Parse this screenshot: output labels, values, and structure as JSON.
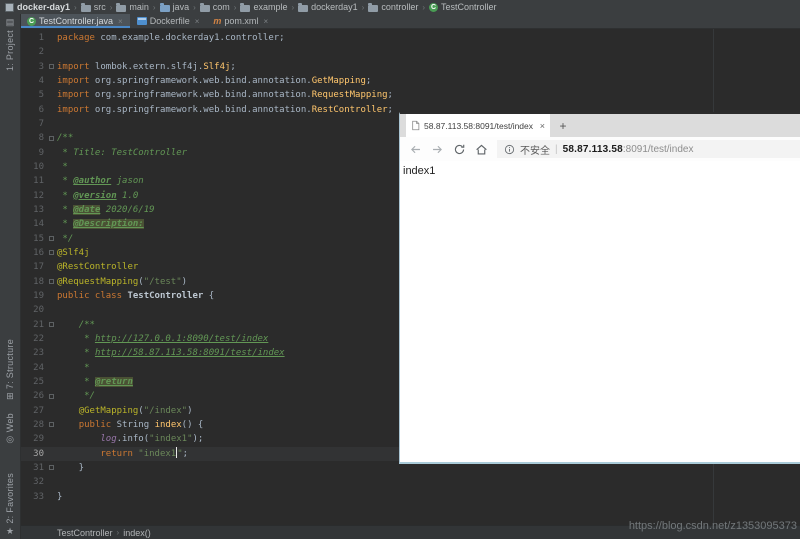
{
  "ide": {
    "breadcrumb": {
      "items": [
        {
          "label": "docker-day1",
          "icon": "project"
        },
        {
          "label": "src",
          "icon": "folder"
        },
        {
          "label": "main",
          "icon": "folder"
        },
        {
          "label": "java",
          "icon": "java-folder"
        },
        {
          "label": "com",
          "icon": "folder"
        },
        {
          "label": "example",
          "icon": "folder"
        },
        {
          "label": "dockerday1",
          "icon": "folder"
        },
        {
          "label": "controller",
          "icon": "folder"
        },
        {
          "label": "TestController",
          "icon": "class"
        }
      ]
    },
    "tabs": [
      {
        "label": "TestController.java",
        "icon": "class",
        "close": "×",
        "active": true
      },
      {
        "label": "Dockerfile",
        "icon": "docker",
        "close": "×",
        "active": false
      },
      {
        "label": "pom.xml",
        "icon": "maven",
        "close": "×",
        "active": false
      }
    ],
    "stripe": {
      "project": {
        "label": "1: Project",
        "icon": "▤"
      },
      "structure": {
        "label": "7: Structure",
        "icon": "⊞"
      },
      "web": {
        "label": "Web",
        "icon": "◎"
      },
      "favorites": {
        "label": "2: Favorites",
        "icon": "★"
      }
    },
    "status_breadcrumb": [
      "TestController",
      "index()"
    ],
    "watermark": "https://blog.csdn.net/z1353095373",
    "colors": {
      "editor_bg": "#2b2b2b",
      "panel_bg": "#3b3e40",
      "active_tab_underline": "#4a88c7",
      "keyword": "#cc7832",
      "string": "#6a8759",
      "comment": "#629755",
      "annotation": "#bbb529",
      "class_ref": "#ffc66d",
      "field": "#9876aa",
      "doc_tag_highlight_bg": "#4a5134",
      "current_line_bg": "#323334"
    }
  },
  "editor": {
    "language": "java",
    "current_line": 30,
    "fold_lines": [
      3,
      8,
      15,
      16,
      18,
      21,
      26,
      28,
      31
    ],
    "lines": [
      {
        "n": 1,
        "seg": [
          [
            "kw",
            "package"
          ],
          [
            "pln",
            " com.example.dockerday1.controller;"
          ]
        ]
      },
      {
        "n": 2,
        "seg": []
      },
      {
        "n": 3,
        "seg": [
          [
            "kw",
            "import"
          ],
          [
            "pln",
            " lombok.extern.slf4j."
          ],
          [
            "cls",
            "Slf4j"
          ],
          [
            "pln",
            ";"
          ]
        ]
      },
      {
        "n": 4,
        "seg": [
          [
            "kw",
            "import"
          ],
          [
            "pln",
            " org.springframework.web.bind.annotation."
          ],
          [
            "cls",
            "GetMapping"
          ],
          [
            "pln",
            ";"
          ]
        ]
      },
      {
        "n": 5,
        "seg": [
          [
            "kw",
            "import"
          ],
          [
            "pln",
            " org.springframework.web.bind.annotation."
          ],
          [
            "cls",
            "RequestMapping"
          ],
          [
            "pln",
            ";"
          ]
        ]
      },
      {
        "n": 6,
        "seg": [
          [
            "kw",
            "import"
          ],
          [
            "pln",
            " org.springframework.web.bind.annotation."
          ],
          [
            "cls",
            "RestController"
          ],
          [
            "pln",
            ";"
          ]
        ]
      },
      {
        "n": 7,
        "seg": []
      },
      {
        "n": 8,
        "seg": [
          [
            "cmt",
            "/**"
          ]
        ]
      },
      {
        "n": 9,
        "seg": [
          [
            "cmt",
            " * Title: TestController"
          ]
        ]
      },
      {
        "n": 10,
        "seg": [
          [
            "cmt",
            " *"
          ]
        ]
      },
      {
        "n": 11,
        "seg": [
          [
            "cmt",
            " * "
          ],
          [
            "tag",
            "@author"
          ],
          [
            "cmt",
            " jason"
          ]
        ]
      },
      {
        "n": 12,
        "seg": [
          [
            "cmt",
            " * "
          ],
          [
            "tag",
            "@version"
          ],
          [
            "cmt",
            " 1.0"
          ]
        ]
      },
      {
        "n": 13,
        "seg": [
          [
            "cmt",
            " * "
          ],
          [
            "tagh",
            "@date"
          ],
          [
            "cmt",
            " 2020/6/19"
          ]
        ]
      },
      {
        "n": 14,
        "seg": [
          [
            "cmt",
            " * "
          ],
          [
            "tagh",
            "@Description:"
          ]
        ]
      },
      {
        "n": 15,
        "seg": [
          [
            "cmt",
            " */"
          ]
        ]
      },
      {
        "n": 16,
        "seg": [
          [
            "ann",
            "@Slf4j"
          ]
        ]
      },
      {
        "n": 17,
        "seg": [
          [
            "ann",
            "@RestController"
          ]
        ]
      },
      {
        "n": 18,
        "seg": [
          [
            "ann",
            "@RequestMapping"
          ],
          [
            "pln",
            "("
          ],
          [
            "str",
            "\"/test\""
          ],
          [
            "pln",
            ")"
          ]
        ]
      },
      {
        "n": 19,
        "seg": [
          [
            "kw",
            "public class "
          ],
          [
            "clsname",
            "TestController "
          ],
          [
            "pln",
            "{"
          ]
        ]
      },
      {
        "n": 20,
        "seg": []
      },
      {
        "n": 21,
        "seg": [
          [
            "pln",
            "    "
          ],
          [
            "cmt",
            "/**"
          ]
        ]
      },
      {
        "n": 22,
        "seg": [
          [
            "cmt",
            "     * "
          ],
          [
            "link",
            "http://127.0.0.1:8090/test/index"
          ]
        ]
      },
      {
        "n": 23,
        "seg": [
          [
            "cmt",
            "     * "
          ],
          [
            "link",
            "http://58.87.113.58:8091/test/index"
          ]
        ]
      },
      {
        "n": 24,
        "seg": [
          [
            "cmt",
            "     *"
          ]
        ]
      },
      {
        "n": 25,
        "seg": [
          [
            "cmt",
            "     * "
          ],
          [
            "tagh",
            "@return"
          ]
        ]
      },
      {
        "n": 26,
        "seg": [
          [
            "cmt",
            "     */"
          ]
        ]
      },
      {
        "n": 27,
        "seg": [
          [
            "pln",
            "    "
          ],
          [
            "ann",
            "@GetMapping"
          ],
          [
            "pln",
            "("
          ],
          [
            "str",
            "\"/index\""
          ],
          [
            "pln",
            ")"
          ]
        ]
      },
      {
        "n": 28,
        "seg": [
          [
            "pln",
            "    "
          ],
          [
            "kw",
            "public "
          ],
          [
            "pln",
            "String "
          ],
          [
            "meth",
            "index"
          ],
          [
            "pln",
            "() {"
          ]
        ]
      },
      {
        "n": 29,
        "seg": [
          [
            "pln",
            "        "
          ],
          [
            "fld",
            "log"
          ],
          [
            "pln",
            ".info("
          ],
          [
            "str",
            "\"index1\""
          ],
          [
            "pln",
            ");"
          ]
        ]
      },
      {
        "n": 30,
        "seg": [
          [
            "pln",
            "        "
          ],
          [
            "kw",
            "return "
          ],
          [
            "str",
            "\"index1"
          ],
          [
            "caret",
            ""
          ],
          [
            "str",
            "\""
          ],
          [
            "pln",
            ";"
          ]
        ]
      },
      {
        "n": 31,
        "seg": [
          [
            "pln",
            "    }"
          ]
        ]
      },
      {
        "n": 32,
        "seg": []
      },
      {
        "n": 33,
        "seg": [
          [
            "pln",
            "}"
          ]
        ]
      }
    ]
  },
  "browser": {
    "tab_title": "58.87.113.58:8091/test/index",
    "tab_close": "×",
    "new_tab_label": "+",
    "security_text": "不安全",
    "address_separator": "|",
    "url_host": "58.87.113.58",
    "url_path": ":8091/test/index",
    "page_text": "index1"
  }
}
